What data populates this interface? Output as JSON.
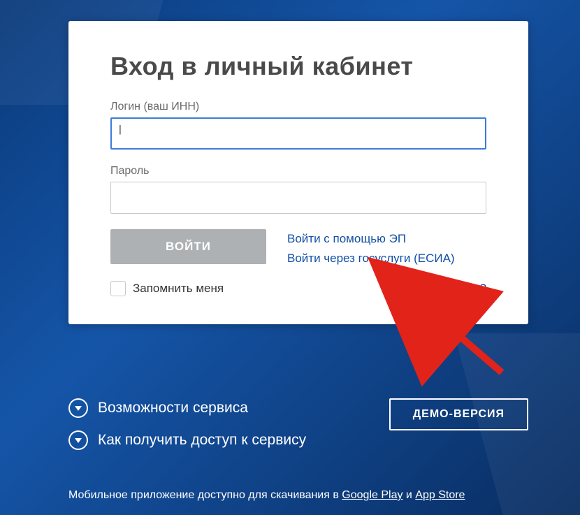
{
  "card": {
    "title": "Вход в личный кабинет",
    "login_label": "Логин (ваш ИНН)",
    "login_value": "",
    "password_label": "Пароль",
    "password_value": "",
    "submit_label": "ВОЙТИ",
    "links": {
      "ep": "Войти с помощью ЭП",
      "esia": "Войти через госуслуги (ЕСИА)"
    },
    "remember_label": "Запомнить меня",
    "forgot_label": "Забыли пароль?"
  },
  "below": {
    "service_features": "Возможности сервиса",
    "how_access": "Как получить доступ к сервису",
    "demo_label": "ДЕМО-ВЕРСИЯ"
  },
  "mobile": {
    "prefix": "Мобильное приложение доступно для скачивания в ",
    "gplay": "Google Play",
    "sep": " и ",
    "appstore": "App Store"
  }
}
